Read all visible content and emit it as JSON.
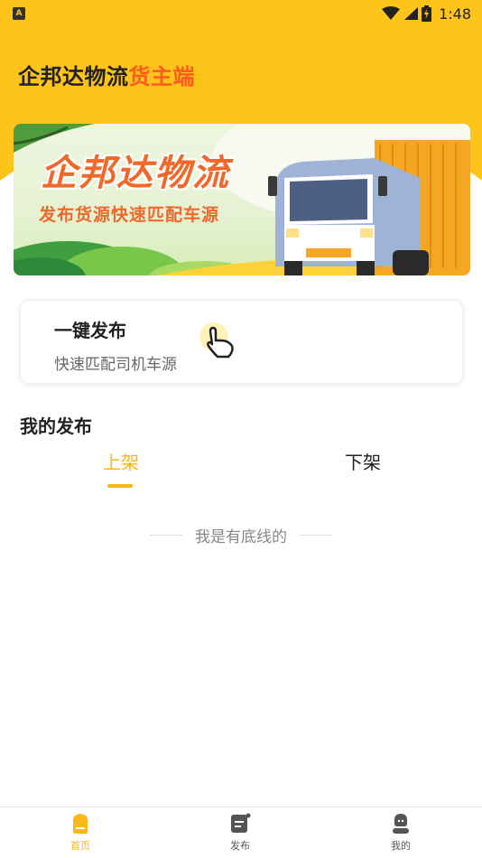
{
  "status_bar": {
    "notification_icon_letter": "A",
    "time": "1:48"
  },
  "header": {
    "title_main": "企邦达物流",
    "title_accent": "货主端"
  },
  "banner": {
    "title": "企邦达物流",
    "subtitle": "发布货源快速匹配车源"
  },
  "publish_card": {
    "title": "一键发布",
    "subtitle": "快速匹配司机车源"
  },
  "my_publish": {
    "title": "我的发布",
    "tabs": [
      {
        "label": "上架",
        "active": true
      },
      {
        "label": "下架",
        "active": false
      }
    ],
    "end_text": "我是有底线的"
  },
  "bottom_nav": {
    "items": [
      {
        "label": "首页",
        "icon": "home-icon",
        "active": true
      },
      {
        "label": "发布",
        "icon": "publish-icon",
        "active": false
      },
      {
        "label": "我的",
        "icon": "profile-icon",
        "active": false
      }
    ]
  },
  "colors": {
    "brand_yellow": "#fec41a",
    "accent_orange": "#ff5a1e",
    "tab_active": "#fbb617"
  }
}
